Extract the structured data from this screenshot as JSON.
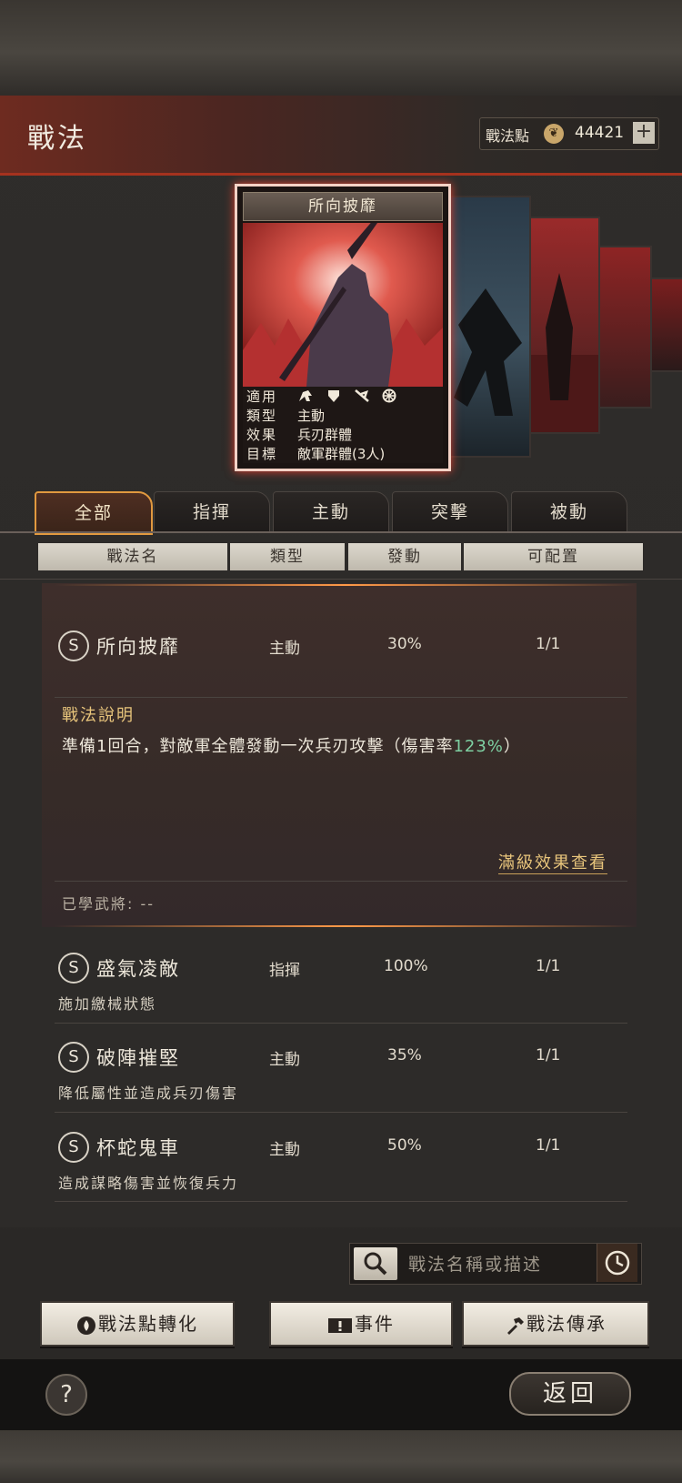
{
  "header": {
    "title": "戰法",
    "points_label": "戰法點",
    "points_value": "44421",
    "add_label": "+"
  },
  "featured_card": {
    "title": "所向披靡",
    "rows": [
      {
        "key": "適用",
        "value": ""
      },
      {
        "key": "類型",
        "value": "主動"
      },
      {
        "key": "效果",
        "value": "兵刃群體"
      },
      {
        "key": "目標",
        "value": "敵軍群體(3人)"
      }
    ]
  },
  "tabs": [
    {
      "label": "全部",
      "active": true
    },
    {
      "label": "指揮",
      "active": false
    },
    {
      "label": "主動",
      "active": false
    },
    {
      "label": "突擊",
      "active": false
    },
    {
      "label": "被動",
      "active": false
    }
  ],
  "columns": [
    "戰法名",
    "類型",
    "發動",
    "可配置"
  ],
  "expanded": {
    "grade": "S",
    "name": "所向披靡",
    "type": "主動",
    "rate": "30%",
    "slots": "1/1",
    "desc_title": "戰法說明",
    "desc_before": "準備1回合，對敵軍全體發動一次兵刃攻擊（傷害率",
    "desc_highlight": "123%",
    "desc_after": "）",
    "full_link": "滿級效果查看",
    "learned": "已學武將: --"
  },
  "list": [
    {
      "grade": "S",
      "name": "盛氣凌敵",
      "type": "指揮",
      "rate": "100%",
      "slots": "1/1",
      "desc": "施加繳械狀態"
    },
    {
      "grade": "S",
      "name": "破陣摧堅",
      "type": "主動",
      "rate": "35%",
      "slots": "1/1",
      "desc": "降低屬性並造成兵刃傷害"
    },
    {
      "grade": "S",
      "name": "杯蛇鬼車",
      "type": "主動",
      "rate": "50%",
      "slots": "1/1",
      "desc": "造成謀略傷害並恢復兵力"
    }
  ],
  "search": {
    "placeholder": "戰法名稱或描述"
  },
  "actions": {
    "convert": "戰法點轉化",
    "events": "事件",
    "inherit": "戰法傳承"
  },
  "bottom": {
    "help": "?",
    "back": "返回"
  },
  "colors": {
    "accent": "#e1993f",
    "highlight": "#7ed0a2",
    "gold": "#e7c47b"
  }
}
